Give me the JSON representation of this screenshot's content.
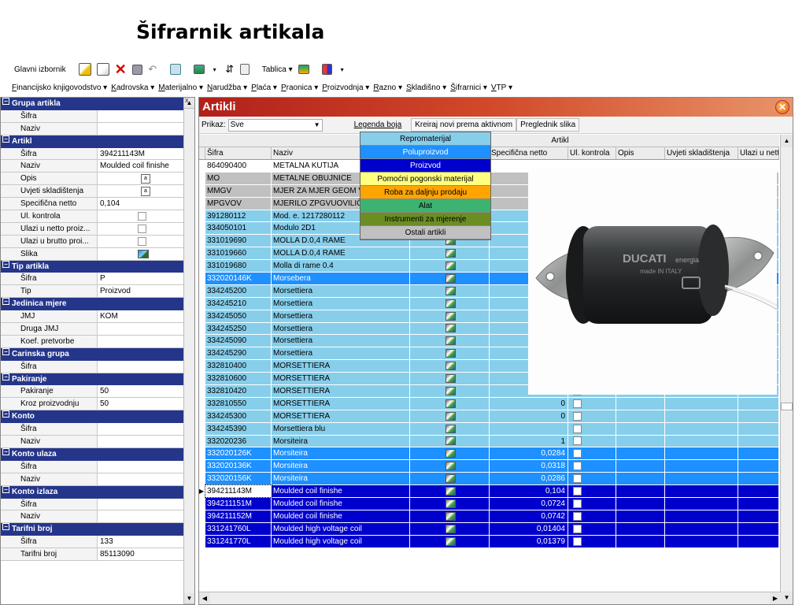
{
  "slide_title": "Šifrarnik artikala",
  "toolbar": {
    "glavni_izbornik": "Glavni izbornik",
    "tablica": "Tablica ▾"
  },
  "menu": [
    {
      "underline": "F",
      "rest": "inancijsko knjigovodstvo ▾"
    },
    {
      "underline": "K",
      "rest": "adrovska ▾"
    },
    {
      "underline": "M",
      "rest": "aterijalno ▾"
    },
    {
      "underline": "N",
      "rest": "arudžba ▾"
    },
    {
      "underline": "P",
      "rest": "laća ▾"
    },
    {
      "underline": "P",
      "rest": "raonica ▾"
    },
    {
      "underline": "P",
      "rest": "roizvodnja ▾"
    },
    {
      "underline": "R",
      "rest": "azno ▾"
    },
    {
      "underline": "S",
      "rest": "kladišno ▾"
    },
    {
      "underline": "Š",
      "rest": "ifrarnici ▾"
    },
    {
      "underline": "V",
      "rest": "TP ▾"
    }
  ],
  "left_panel": {
    "close_glyph": "x",
    "rows": [
      {
        "type": "cat",
        "label": "Grupa artikla"
      },
      {
        "type": "kv",
        "key": "Šifra",
        "value": ""
      },
      {
        "type": "kv",
        "key": "Naziv",
        "value": ""
      },
      {
        "type": "cat",
        "label": "Artikl"
      },
      {
        "type": "kv",
        "key": "Šifra",
        "value": "394211143M"
      },
      {
        "type": "kv",
        "key": "Naziv",
        "value": "Moulded coil finishe"
      },
      {
        "type": "kv",
        "key": "Opis",
        "value": "",
        "widget": "memo"
      },
      {
        "type": "kv",
        "key": "Uvjeti skladištenja",
        "value": "",
        "widget": "memo"
      },
      {
        "type": "kv",
        "key": "Specifična netto",
        "value": "0,104"
      },
      {
        "type": "kv",
        "key": "Ul. kontrola",
        "value": "",
        "widget": "check"
      },
      {
        "type": "kv",
        "key": "Ulazi u netto proiz...",
        "value": "",
        "widget": "check"
      },
      {
        "type": "kv",
        "key": "Ulazi u brutto proi...",
        "value": "",
        "widget": "check"
      },
      {
        "type": "kv",
        "key": "Slika",
        "value": "",
        "widget": "image"
      },
      {
        "type": "cat",
        "label": "Tip artikla"
      },
      {
        "type": "kv",
        "key": "Šifra",
        "value": "P"
      },
      {
        "type": "kv",
        "key": "Tip",
        "value": "Proizvod"
      },
      {
        "type": "cat",
        "label": "Jedinica mjere"
      },
      {
        "type": "kv",
        "key": "JMJ",
        "value": "KOM"
      },
      {
        "type": "kv",
        "key": "Druga JMJ",
        "value": ""
      },
      {
        "type": "kv",
        "key": "Koef. pretvorbe",
        "value": ""
      },
      {
        "type": "cat",
        "label": "Carinska grupa"
      },
      {
        "type": "kv",
        "key": "Šifra",
        "value": ""
      },
      {
        "type": "cat",
        "label": "Pakiranje"
      },
      {
        "type": "kv",
        "key": "Pakiranje",
        "value": "50"
      },
      {
        "type": "kv",
        "key": "Kroz proizvodnju",
        "value": "50"
      },
      {
        "type": "cat",
        "label": "Konto"
      },
      {
        "type": "kv",
        "key": "Šifra",
        "value": ""
      },
      {
        "type": "kv",
        "key": "Naziv",
        "value": ""
      },
      {
        "type": "cat",
        "label": "Konto ulaza"
      },
      {
        "type": "kv",
        "key": "Šifra",
        "value": ""
      },
      {
        "type": "kv",
        "key": "Naziv",
        "value": ""
      },
      {
        "type": "cat",
        "label": "Konto izlaza"
      },
      {
        "type": "kv",
        "key": "Šifra",
        "value": ""
      },
      {
        "type": "kv",
        "key": "Naziv",
        "value": ""
      },
      {
        "type": "cat",
        "label": "Tarifni broj"
      },
      {
        "type": "kv",
        "key": "Šifra",
        "value": "133"
      },
      {
        "type": "kv",
        "key": "Tarifni broj",
        "value": "85113090"
      }
    ]
  },
  "main": {
    "title": "Artikli",
    "prikaz_label": "Prikaz:",
    "prikaz_value": "Sve",
    "legenda_button": "Legenda boja",
    "kreiraj_button": "Kreiraj novi prema aktivnom",
    "preglednik_button": "Preglednik slika",
    "group_header": "Artikl",
    "columns": [
      "Šifra",
      "Naziv",
      "",
      "Specifična netto",
      "Ul. kontrola",
      "Opis",
      "Uvjeti skladištenja",
      "Ulazi u netto"
    ],
    "rows": [
      {
        "sifra": "864090400",
        "naziv": "METALNA KUTIJA",
        "netto": "",
        "color": "#ffffff",
        "text": "#000"
      },
      {
        "sifra": "MO",
        "naziv": "METALNE OBUJNICE",
        "netto": "",
        "color": "#c0c0c0",
        "text": "#000"
      },
      {
        "sifra": "MMGV",
        "naziv": "MJER ZA MJER GEOM V",
        "netto": "",
        "color": "#c0c0c0",
        "text": "#000"
      },
      {
        "sifra": "MPGVOV",
        "naziv": "MJERILO ZPGVUOVILIČ",
        "netto": "",
        "color": "#c0c0c0",
        "text": "#000"
      },
      {
        "sifra": "391280112",
        "naziv": "Mod. e. 1217280112",
        "netto": "",
        "color": "#87ceeb",
        "text": "#000",
        "icon": true
      },
      {
        "sifra": "334050101",
        "naziv": "Modulo 2D1",
        "netto": "",
        "color": "#87ceeb",
        "text": "#000",
        "icon": true
      },
      {
        "sifra": "331019690",
        "naziv": "MOLLA D.0,4 RAME",
        "netto": "",
        "color": "#87ceeb",
        "text": "#000",
        "icon": true
      },
      {
        "sifra": "331019660",
        "naziv": "MOLLA D.0,4 RAME",
        "netto": "",
        "color": "#87ceeb",
        "text": "#000",
        "icon": true
      },
      {
        "sifra": "331019680",
        "naziv": "Molla di rame 0.4",
        "netto": "",
        "color": "#87ceeb",
        "text": "#000",
        "icon": true
      },
      {
        "sifra": "332020146K",
        "naziv": "Morsebera",
        "netto": "",
        "color": "#1e90ff",
        "text": "#fff",
        "icon": true
      },
      {
        "sifra": "334245200",
        "naziv": "Morsettiera",
        "netto": "",
        "color": "#87ceeb",
        "text": "#000",
        "icon": true
      },
      {
        "sifra": "334245210",
        "naziv": "Morsettiera",
        "netto": "",
        "color": "#87ceeb",
        "text": "#000",
        "icon": true
      },
      {
        "sifra": "334245050",
        "naziv": "Morsettiera",
        "netto": "",
        "color": "#87ceeb",
        "text": "#000",
        "icon": true
      },
      {
        "sifra": "334245250",
        "naziv": "Morsettiera",
        "netto": "",
        "color": "#87ceeb",
        "text": "#000",
        "icon": true
      },
      {
        "sifra": "334245090",
        "naziv": "Morsettiera",
        "netto": "",
        "color": "#87ceeb",
        "text": "#000",
        "icon": true
      },
      {
        "sifra": "334245290",
        "naziv": "Morsettiera",
        "netto": "",
        "color": "#87ceeb",
        "text": "#000",
        "icon": true
      },
      {
        "sifra": "332810400",
        "naziv": "MORSETTIERA",
        "netto": "",
        "color": "#87ceeb",
        "text": "#000",
        "icon": true
      },
      {
        "sifra": "332810600",
        "naziv": "MORSETTIERA",
        "netto": "0",
        "color": "#87ceeb",
        "text": "#000",
        "icon": true,
        "box": true
      },
      {
        "sifra": "332810420",
        "naziv": "MORSETTIERA",
        "netto": "0",
        "color": "#87ceeb",
        "text": "#000",
        "icon": true,
        "box": true
      },
      {
        "sifra": "332810550",
        "naziv": "MORSETTIERA",
        "netto": "0",
        "color": "#87ceeb",
        "text": "#000",
        "icon": true,
        "box": true
      },
      {
        "sifra": "334245300",
        "naziv": "MORSETTIERA",
        "netto": "0",
        "color": "#87ceeb",
        "text": "#000",
        "icon": true,
        "box": true
      },
      {
        "sifra": "334245390",
        "naziv": "Morsettiera blu",
        "netto": "",
        "color": "#87ceeb",
        "text": "#000",
        "icon": true,
        "box": true
      },
      {
        "sifra": "332020236",
        "naziv": "Morsiteira",
        "netto": "1",
        "color": "#87ceeb",
        "text": "#000",
        "icon": true,
        "box": true
      },
      {
        "sifra": "332020126K",
        "naziv": "Morsiteira",
        "netto": "0,0284",
        "color": "#1e90ff",
        "text": "#fff",
        "icon": true,
        "box": true
      },
      {
        "sifra": "332020136K",
        "naziv": "Morsiteira",
        "netto": "0,0318",
        "color": "#1e90ff",
        "text": "#fff",
        "icon": true,
        "box": true
      },
      {
        "sifra": "332020156K",
        "naziv": "Morsiteira",
        "netto": "0,0286",
        "color": "#1e90ff",
        "text": "#fff",
        "icon": true,
        "box": true
      },
      {
        "sifra": "394211143M",
        "naziv": "Moulded coil finishe",
        "netto": "0,104",
        "color": "#0000cd",
        "text": "#fff",
        "icon": true,
        "box": true,
        "selected": true
      },
      {
        "sifra": "394211151M",
        "naziv": "Moulded coil finishe",
        "netto": "0,0724",
        "color": "#0000cd",
        "text": "#fff",
        "icon": true,
        "box": true
      },
      {
        "sifra": "394211152M",
        "naziv": "Moulded coil finishe",
        "netto": "0,0742",
        "color": "#0000cd",
        "text": "#fff",
        "icon": true,
        "box": true
      },
      {
        "sifra": "331241760L",
        "naziv": "Moulded high voltage coil",
        "netto": "0,01404",
        "color": "#0000cd",
        "text": "#fff",
        "icon": true,
        "box": true
      },
      {
        "sifra": "331241770L",
        "naziv": "Moulded high voltage coil",
        "netto": "0,01379",
        "color": "#0000cd",
        "text": "#fff",
        "icon": true,
        "box": true
      }
    ],
    "legend": [
      {
        "label": "Repromaterijal",
        "bg": "#87ceeb",
        "fg": "#000"
      },
      {
        "label": "Poluproizvod",
        "bg": "#1e90ff",
        "fg": "#fff"
      },
      {
        "label": "Proizvod",
        "bg": "#0000cd",
        "fg": "#fff"
      },
      {
        "label": "Pomoćni pogonski materijal",
        "bg": "#ffff80",
        "fg": "#000"
      },
      {
        "label": "Roba za daljnju prodaju",
        "bg": "#ffa500",
        "fg": "#000"
      },
      {
        "label": "Alat",
        "bg": "#3cb371",
        "fg": "#000"
      },
      {
        "label": "Instrumenti za mjerenje",
        "bg": "#6b8e23",
        "fg": "#000"
      },
      {
        "label": "Ostali artikli",
        "bg": "#c0c0c0",
        "fg": "#000"
      }
    ],
    "photo_text": {
      "brand": "DUCATI",
      "brand_suffix": "energia",
      "made_in": "made IN ITALY"
    }
  }
}
